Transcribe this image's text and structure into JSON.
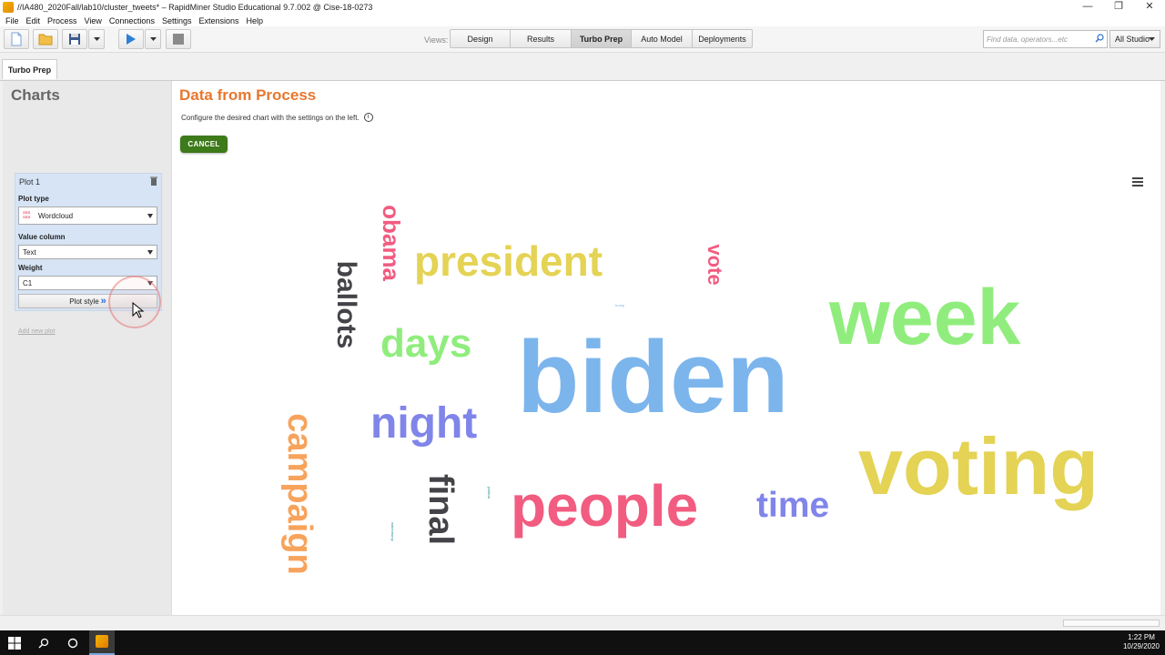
{
  "window": {
    "title": "//IA480_2020Fall/lab10/cluster_tweets* – RapidMiner Studio Educational 9.7.002 @ Cise-18-0273",
    "controls": [
      "—",
      "❐",
      "✕"
    ]
  },
  "menubar": [
    "File",
    "Edit",
    "Process",
    "View",
    "Connections",
    "Settings",
    "Extensions",
    "Help"
  ],
  "toolbar": {
    "views_label": "Views:",
    "views": [
      {
        "label": "Design",
        "active": false
      },
      {
        "label": "Results",
        "active": false
      },
      {
        "label": "Turbo Prep",
        "active": true
      },
      {
        "label": "Auto Model",
        "active": false
      },
      {
        "label": "Deployments",
        "active": false
      }
    ],
    "search_placeholder": "Find data, operators...etc",
    "studio_select": "All Studio"
  },
  "tab": {
    "label": "Turbo Prep"
  },
  "left": {
    "title": "Charts",
    "plot": {
      "name": "Plot 1",
      "plot_type_label": "Plot type",
      "plot_type_value": "Wordcloud",
      "value_column_label": "Value column",
      "value_column_value": "Text",
      "weight_label": "Weight",
      "weight_value": "C1",
      "plot_style_label": "Plot style"
    },
    "add_new_plot": "Add new plot"
  },
  "main": {
    "title": "Data from Process",
    "subtitle": "Configure the desired chart with the settings on the left.",
    "cancel_label": "CANCEL"
  },
  "wordcloud": {
    "words": [
      {
        "text": "biden",
        "color": "#7cb5ec"
      },
      {
        "text": "week",
        "color": "#90ed7d"
      },
      {
        "text": "voting",
        "color": "#e4d354"
      },
      {
        "text": "people",
        "color": "#f15c80"
      },
      {
        "text": "president",
        "color": "#e4d354"
      },
      {
        "text": "night",
        "color": "#8085e9"
      },
      {
        "text": "days",
        "color": "#90ed7d"
      },
      {
        "text": "time",
        "color": "#8085e9"
      },
      {
        "text": "campaign",
        "color": "#f7a35c"
      },
      {
        "text": "final",
        "color": "#434348"
      },
      {
        "text": "ballots",
        "color": "#434348"
      },
      {
        "text": "obama",
        "color": "#f15c80"
      },
      {
        "text": "vote",
        "color": "#f15c80"
      }
    ],
    "tiny_words": [
      "trump",
      "political",
      "watchtrump"
    ]
  },
  "taskbar": {
    "time": "1:22 PM",
    "date": "10/29/2020"
  }
}
